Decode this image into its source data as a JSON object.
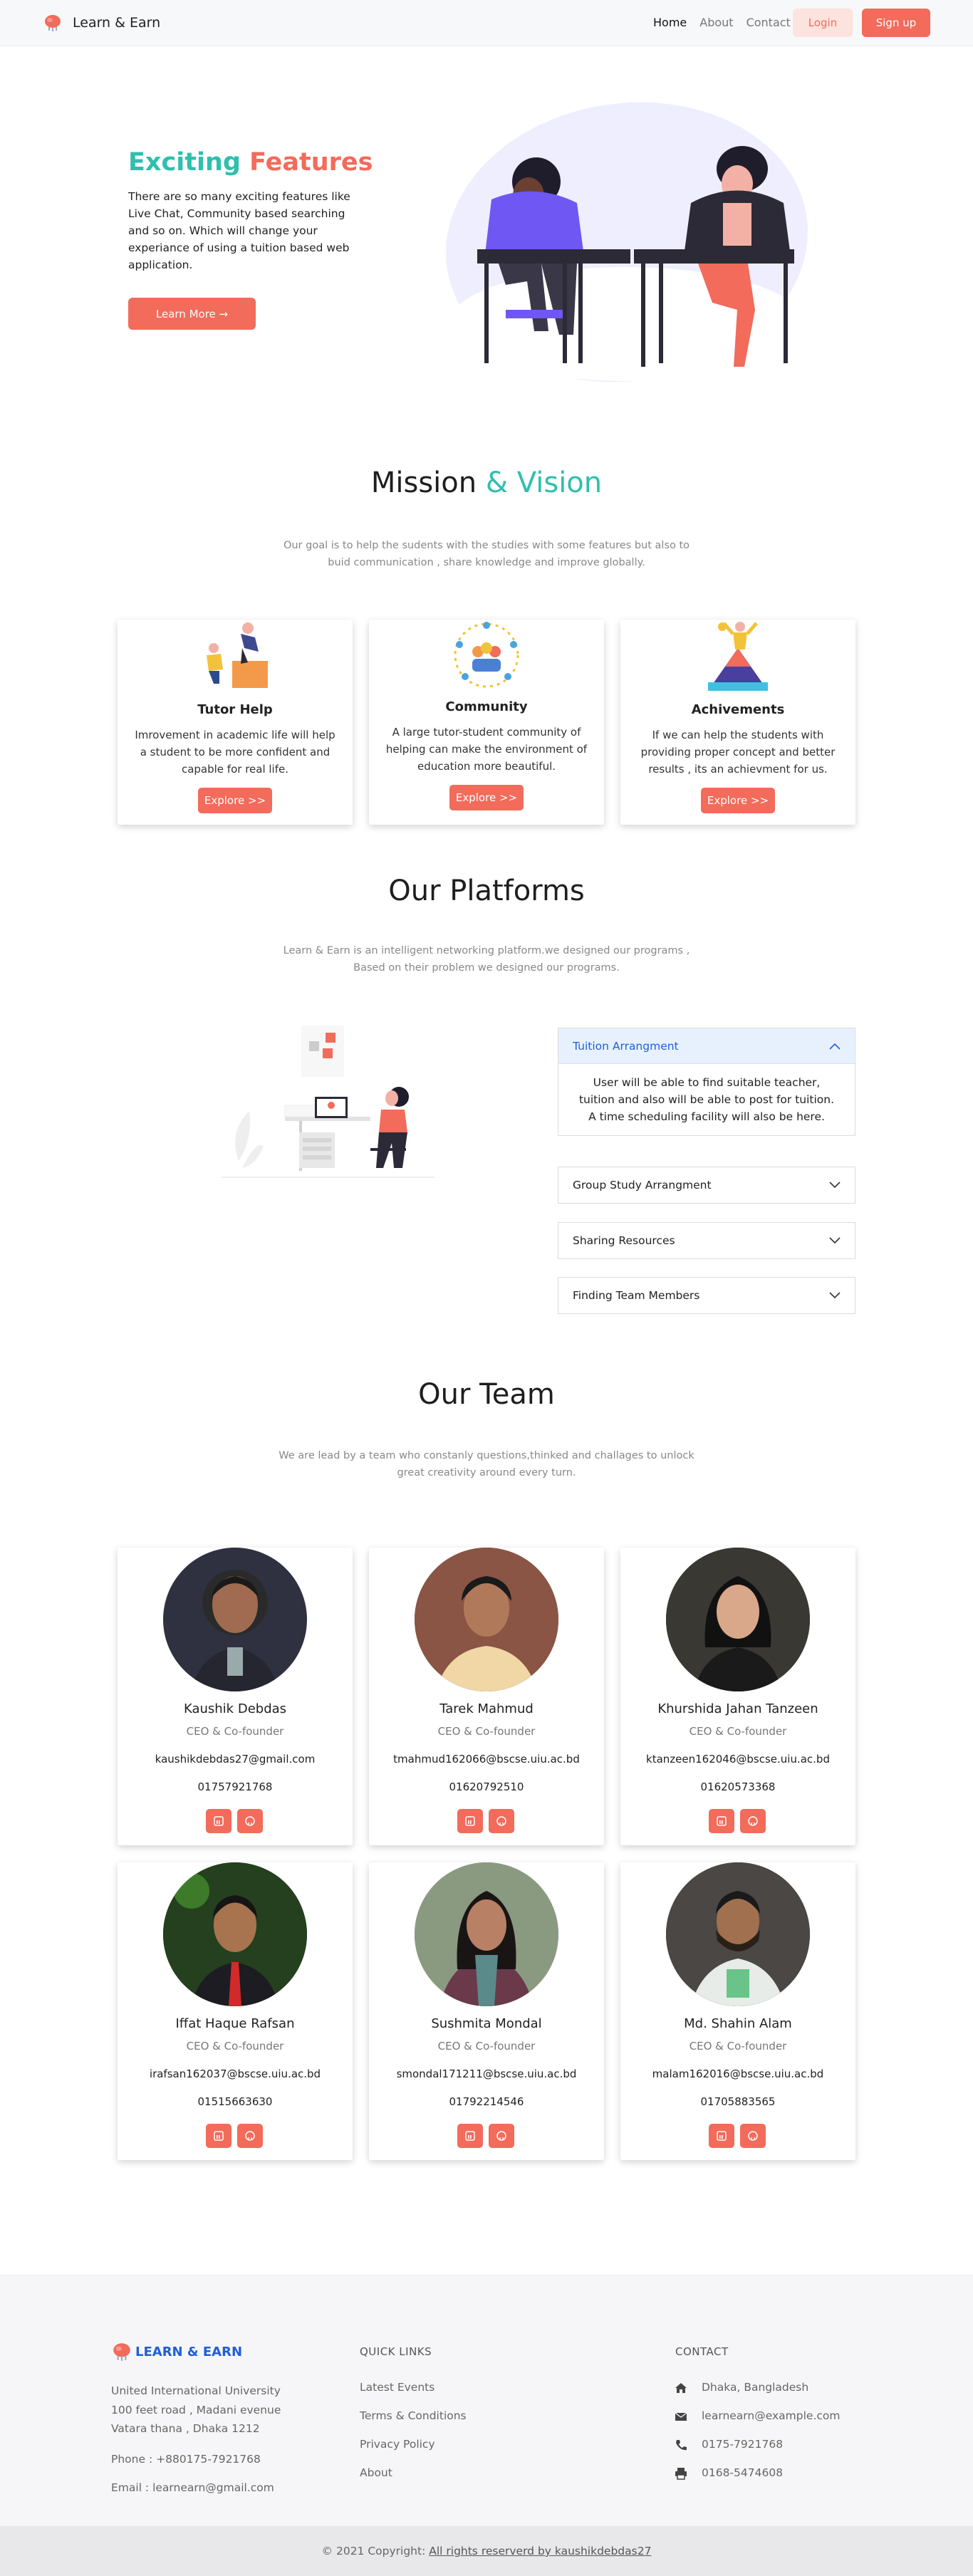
{
  "nav": {
    "brand": "Learn & Earn",
    "links": [
      "Home",
      "About",
      "Contact"
    ],
    "login": "Login",
    "signup": "Sign up"
  },
  "hero": {
    "title_word1": "Exciting",
    "title_word2": "Features",
    "text": "There are so many exciting features like Live Chat, Community based searching and so on. Which will change your experiance of using a tuition based web application.",
    "button": "Learn More →"
  },
  "mission": {
    "title_part1": "Mission",
    "title_part2": "& Vision",
    "subtitle": "Our goal is to help the sudents with the studies with some features but also to buid communication , share knowledge and improve globally.",
    "cards": [
      {
        "title": "Tutor Help",
        "text": "Imrovement in academic life will help a student to be more confident and capable for real life.",
        "button": "Explore >>",
        "icon": "tutor-icon"
      },
      {
        "title": "Community",
        "text": "A large tutor-student community of helping can make the environment of education more beautiful.",
        "button": "Explore >>",
        "icon": "community-icon"
      },
      {
        "title": "Achivements",
        "text": "If we can help the students with providing proper concept and better results , its an achievment for us.",
        "button": "Explore >>",
        "icon": "achievement-icon"
      }
    ]
  },
  "platforms": {
    "title": "Our Platforms",
    "subtitle": "Learn & Earn is an intelligent networking platform.we designed our programs , Based on their problem we designed our programs.",
    "accordion": [
      {
        "title": "Tuition Arrangment",
        "body": "User will be able to find suitable teacher, tuition and also will be able to post for tuition. A time scheduling facility will also be here.",
        "open": true
      },
      {
        "title": "Group Study Arrangment",
        "open": false
      },
      {
        "title": "Sharing Resources",
        "open": false
      },
      {
        "title": "Finding Team Members",
        "open": false
      }
    ]
  },
  "team": {
    "title": "Our Team",
    "subtitle": "We are lead by a team who constanly questions,thinked and challages to unlock great creativity around every turn.",
    "members": [
      {
        "name": "Kaushik Debdas",
        "role": "CEO & Co-founder",
        "email": "kaushikdebdas27@gmail.com",
        "phone": "01757921768"
      },
      {
        "name": "Tarek Mahmud",
        "role": "CEO & Co-founder",
        "email": "tmahmud162066@bscse.uiu.ac.bd",
        "phone": "01620792510"
      },
      {
        "name": "Khurshida Jahan Tanzeen",
        "role": "CEO & Co-founder",
        "email": "ktanzeen162046@bscse.uiu.ac.bd",
        "phone": "01620573368"
      },
      {
        "name": "Iffat Haque Rafsan",
        "role": "CEO & Co-founder",
        "email": "irafsan162037@bscse.uiu.ac.bd",
        "phone": "01515663630"
      },
      {
        "name": "Sushmita Mondal",
        "role": "CEO & Co-founder",
        "email": "smondal171211@bscse.uiu.ac.bd",
        "phone": "01792214546"
      },
      {
        "name": "Md. Shahin Alam",
        "role": "CEO & Co-founder",
        "email": "malam162016@bscse.uiu.ac.bd",
        "phone": "01705883565"
      }
    ]
  },
  "footer": {
    "brand": "LEARN & EARN",
    "address1": "United International University",
    "address2": "100 feet road , Madani evenue",
    "address3": "Vatara thana , Dhaka 1212",
    "phone": "Phone : +880175-7921768",
    "email": "Email : learnearn@gmail.com",
    "quick_links_title": "QUICK LINKS",
    "quick_links": [
      "Latest Events",
      "Terms & Conditions",
      "Privacy Policy",
      "About"
    ],
    "contact_title": "CONTACT",
    "contact": [
      {
        "icon": "home-icon",
        "text": "Dhaka, Bangladesh"
      },
      {
        "icon": "envelope-icon",
        "text": "learnearn@example.com"
      },
      {
        "icon": "phone-icon",
        "text": "0175-7921768"
      },
      {
        "icon": "print-icon",
        "text": "0168-5474608"
      }
    ],
    "copyright_prefix": "© 2021 Copyright:",
    "copyright_link": "All rights reserverd by kaushikdebdas27"
  },
  "colors": {
    "accent": "#f26b5b",
    "teal": "#2fbfae",
    "link_blue": "#1f5fd6"
  }
}
